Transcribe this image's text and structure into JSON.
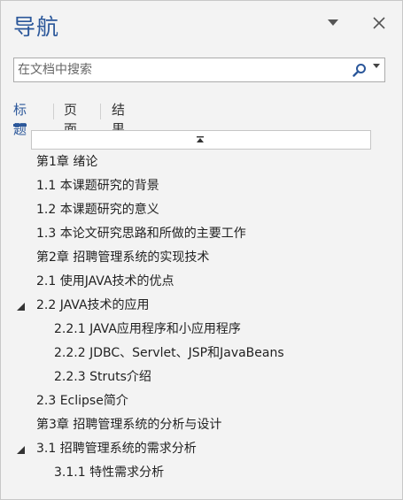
{
  "pane": {
    "title": "导航",
    "dropdown_icon": "chevron-down-icon",
    "close_icon": "close-icon"
  },
  "search": {
    "placeholder": "在文档中搜索",
    "value": "",
    "icon": "search-icon",
    "options_icon": "dropdown-caret-icon"
  },
  "tabs": [
    {
      "label": "标题",
      "active": true
    },
    {
      "label": "页面",
      "active": false
    },
    {
      "label": "结果",
      "active": false
    }
  ],
  "colors": {
    "accent": "#2b579a",
    "background": "#f3f3f3"
  },
  "headings": [
    {
      "label": "第1章 绪论",
      "level": 1,
      "expandable": false
    },
    {
      "label": "1.1 本课题研究的背景",
      "level": 1,
      "expandable": false
    },
    {
      "label": "1.2 本课题研究的意义",
      "level": 1,
      "expandable": false
    },
    {
      "label": "1.3 本论文研究思路和所做的主要工作",
      "level": 1,
      "expandable": false
    },
    {
      "label": "第2章 招聘管理系统的实现技术",
      "level": 1,
      "expandable": false
    },
    {
      "label": "2.1 使用JAVA技术的优点",
      "level": 1,
      "expandable": false
    },
    {
      "label": "2.2 JAVA技术的应用",
      "level": 1,
      "expandable": true,
      "expanded": true
    },
    {
      "label": "2.2.1 JAVA应用程序和小应用程序",
      "level": 2,
      "expandable": false
    },
    {
      "label": "2.2.2 JDBC、Servlet、JSP和JavaBeans",
      "level": 2,
      "expandable": false
    },
    {
      "label": "2.2.3 Struts介绍",
      "level": 2,
      "expandable": false
    },
    {
      "label": "2.3 Eclipse简介",
      "level": 1,
      "expandable": false
    },
    {
      "label": "第3章  招聘管理系统的分析与设计",
      "level": 1,
      "expandable": false
    },
    {
      "label": "3.1 招聘管理系统的需求分析",
      "level": 1,
      "expandable": true,
      "expanded": true
    },
    {
      "label": "3.1.1 特性需求分析",
      "level": 2,
      "expandable": false
    }
  ]
}
